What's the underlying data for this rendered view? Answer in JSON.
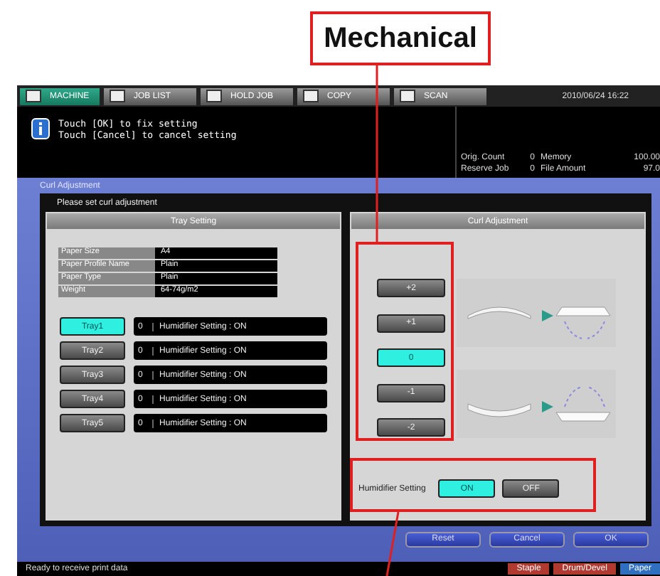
{
  "annotation": {
    "label": "Mechanical"
  },
  "tabs": [
    {
      "label": "MACHINE",
      "selected": true
    },
    {
      "label": "JOB LIST",
      "selected": false
    },
    {
      "label": "HOLD JOB",
      "selected": false
    },
    {
      "label": "COPY",
      "selected": false
    },
    {
      "label": "SCAN",
      "selected": false
    }
  ],
  "clock": "2010/06/24 16:22",
  "message": [
    "Touch [OK] to fix setting",
    "Touch [Cancel] to cancel setting"
  ],
  "counters": [
    {
      "label": "Orig. Count",
      "value": "0"
    },
    {
      "label": "Memory",
      "value": "100.00"
    },
    {
      "label": "Reserve Job",
      "value": "0"
    },
    {
      "label": "File Amount",
      "value": "97.0"
    }
  ],
  "screen_title": "Curl Adjustment",
  "prompt": "Please set curl adjustment",
  "tray_setting": {
    "title": "Tray Setting",
    "info": [
      {
        "label": "Paper Size",
        "value": "A4"
      },
      {
        "label": "Paper Profile Name",
        "value": "Plain"
      },
      {
        "label": "Paper Type",
        "value": "Plain"
      },
      {
        "label": "Weight",
        "value": "64-74g/m2"
      }
    ],
    "trays": [
      {
        "label": "Tray1",
        "selected": true,
        "value": "0",
        "setting": "Humidifier Setting : ON"
      },
      {
        "label": "Tray2",
        "selected": false,
        "value": "0",
        "setting": "Humidifier Setting : ON"
      },
      {
        "label": "Tray3",
        "selected": false,
        "value": "0",
        "setting": "Humidifier Setting : ON"
      },
      {
        "label": "Tray4",
        "selected": false,
        "value": "0",
        "setting": "Humidifier Setting : ON"
      },
      {
        "label": "Tray5",
        "selected": false,
        "value": "0",
        "setting": "Humidifier Setting : ON"
      }
    ]
  },
  "curl_adjustment": {
    "title": "Curl Adjustment",
    "levels": [
      {
        "label": "+2",
        "selected": false
      },
      {
        "label": "+1",
        "selected": false
      },
      {
        "label": "0",
        "selected": true
      },
      {
        "label": "-1",
        "selected": false
      },
      {
        "label": "-2",
        "selected": false
      }
    ]
  },
  "humidifier": {
    "label": "Humidifier Setting",
    "options": [
      {
        "label": "ON",
        "selected": true
      },
      {
        "label": "OFF",
        "selected": false
      }
    ]
  },
  "buttons": [
    "Reset",
    "Cancel",
    "OK"
  ],
  "status": {
    "text": "Ready to receive print data",
    "indicators": [
      {
        "label": "Staple",
        "color": "#b03a30"
      },
      {
        "label": "Drum/Devel",
        "color": "#b03a30"
      },
      {
        "label": "Paper",
        "color": "#2f6fc0"
      }
    ]
  }
}
